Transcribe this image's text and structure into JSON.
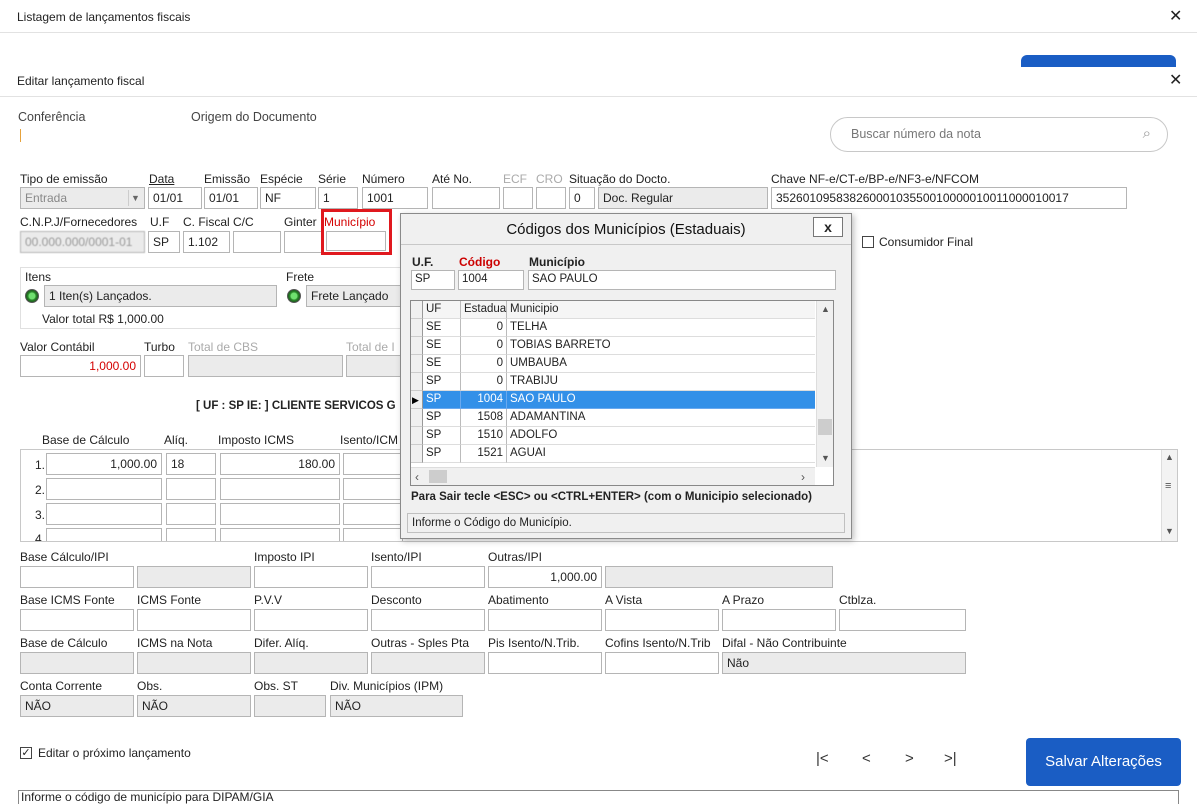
{
  "window": {
    "title": "Listagem de lançamentos fiscais",
    "subtitle": "Editar lançamento fiscal"
  },
  "tabs": [
    "Conferência",
    "Origem do Documento"
  ],
  "search": {
    "placeholder": "Buscar número da nota"
  },
  "header_labels": {
    "tipo_emissao": "Tipo de emissão",
    "data": "Data",
    "emissao": "Emissão",
    "especie": "Espécie",
    "serie": "Série",
    "numero": "Número",
    "ate_no": "Até No.",
    "ecf": "ECF",
    "cro": "CRO",
    "situacao": "Situação do Docto.",
    "chave": "Chave NF-e/CT-e/BP-e/NF3-e/NFCOM",
    "cnpj": "C.N.P.J/Fornecedores",
    "uf": "U.F",
    "cfiscal": "C. Fiscal",
    "cc": "C/C",
    "ginter": "Ginter",
    "municipio": "Município",
    "consumidor_final": "Consumidor Final"
  },
  "header_values": {
    "tipo_emissao": "Entrada",
    "data": "01/01",
    "emissao": "01/01",
    "especie": "NF",
    "serie": "1",
    "numero": "1001",
    "situacao_code": "0",
    "situacao_desc": "Doc. Regular",
    "chave": "35260109583826000103550010000010011000010017",
    "cnpj": "00.000.000/0001-01",
    "uf": "SP",
    "cfiscal": "1.102"
  },
  "itens": {
    "label": "Itens",
    "value": "1 Iten(s) Lançados.",
    "total": "Valor total R$ 1,000.00"
  },
  "frete": {
    "label": "Frete",
    "value": "Frete Lançado"
  },
  "valores": {
    "valor_contabil_label": "Valor Contábil",
    "valor_contabil": "1,000.00",
    "turbo_label": "Turbo",
    "total_cbs_label": "Total de CBS",
    "total_ibs_label": "Total de I"
  },
  "client_line": "[ UF : SP IE: ] CLIENTE SERVICOS G",
  "icms_table": {
    "headers": [
      "Base de Cálculo",
      "Alíq.",
      "Imposto ICMS",
      "Isento/ICM"
    ],
    "rows": [
      {
        "n": "1.",
        "base": "1,000.00",
        "aliq": "18",
        "imposto": "180.00"
      },
      {
        "n": "2.",
        "base": "",
        "aliq": "",
        "imposto": ""
      },
      {
        "n": "3.",
        "base": "",
        "aliq": "",
        "imposto": ""
      },
      {
        "n": "4",
        "base": "",
        "aliq": "",
        "imposto": ""
      }
    ]
  },
  "ipi": {
    "base_calculo_ipi": "Base Cálculo/IPI",
    "imposto_ipi": "Imposto IPI",
    "isento_ipi": "Isento/IPI",
    "outras_ipi": "Outras/IPI",
    "outras_ipi_value": "1,000.00"
  },
  "fonte": {
    "base_icms_fonte": "Base ICMS Fonte",
    "icms_fonte": "ICMS Fonte",
    "pvv": "P.V.V",
    "desconto": "Desconto",
    "abatimento": "Abatimento",
    "a_vista": "A Vista",
    "a_prazo": "A Prazo",
    "ctblza": "Ctblza."
  },
  "calc2": {
    "base_calculo": "Base de Cálculo",
    "icms_nota": "ICMS na Nota",
    "difer_aliq": "Difer. Alíq.",
    "outras_sples": "Outras - Sples Pta",
    "pis_isento": "Pis Isento/N.Trib.",
    "cofins_isento": "Cofins Isento/N.Trib",
    "difal": "Difal - Não Contribuinte",
    "difal_value": "Não"
  },
  "conta": {
    "conta_corrente": "Conta Corrente",
    "conta_corrente_value": "NÃO",
    "obs": "Obs.",
    "obs_value": "NÃO",
    "obs_st": "Obs. ST",
    "div_municipios": "Div. Municípios (IPM)",
    "div_municipios_value": "NÃO"
  },
  "footer": {
    "editar_proximo": "Editar o próximo lançamento",
    "save": "Salvar Alterações",
    "status": "Informe o código de município para DIPAM/GIA",
    "nav": {
      "first": "|<",
      "prev": "<",
      "next": ">",
      "last": ">|"
    }
  },
  "popup": {
    "title": "Códigos dos Municípios (Estaduais)",
    "close": "x",
    "uf_label": "U.F.",
    "codigo_label": "Código",
    "municipio_label": "Município",
    "uf_value": "SP",
    "codigo_value": "1004",
    "municipio_value": "SAO PAULO",
    "grid_headers": [
      "UF",
      "Estadual",
      "Municipio"
    ],
    "grid_rows": [
      {
        "uf": "SE",
        "estadual": "0",
        "municipio": "TELHA"
      },
      {
        "uf": "SE",
        "estadual": "0",
        "municipio": "TOBIAS BARRETO"
      },
      {
        "uf": "SE",
        "estadual": "0",
        "municipio": "UMBAUBA"
      },
      {
        "uf": "SP",
        "estadual": "0",
        "municipio": "TRABIJU"
      },
      {
        "uf": "SP",
        "estadual": "1004",
        "municipio": "SAO PAULO"
      },
      {
        "uf": "SP",
        "estadual": "1508",
        "municipio": "ADAMANTINA"
      },
      {
        "uf": "SP",
        "estadual": "1510",
        "municipio": "ADOLFO"
      },
      {
        "uf": "SP",
        "estadual": "1521",
        "municipio": "AGUAI"
      }
    ],
    "selected_row": 4,
    "hint": "Para Sair tecle <ESC> ou  <CTRL+ENTER> (com o Municipio selecionado)",
    "status": "Informe o Código do Município."
  },
  "colors": {
    "accent": "#1a5dc4",
    "highlight": "#d40000",
    "selected_row": "#3390e8"
  }
}
